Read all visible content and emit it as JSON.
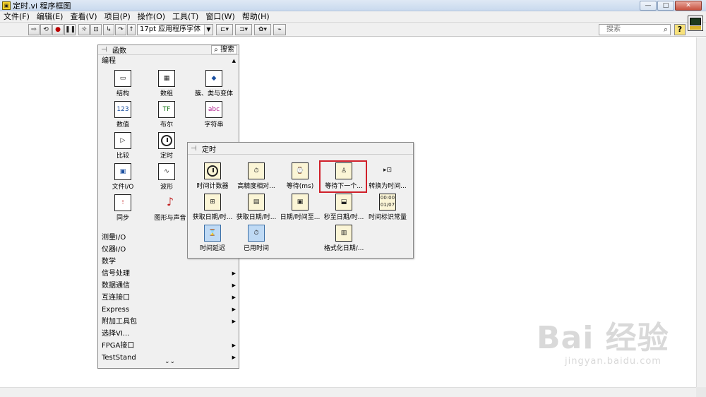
{
  "window": {
    "title": "定时.vi 程序框图",
    "buttons": [
      "—",
      "□",
      "✕"
    ]
  },
  "menu": [
    "文件(F)",
    "编辑(E)",
    "查看(V)",
    "项目(P)",
    "操作(O)",
    "工具(T)",
    "窗口(W)",
    "帮助(H)"
  ],
  "toolbar": {
    "font": "17pt 应用程序字体",
    "search_placeholder": "搜索",
    "help": "?"
  },
  "functions_palette": {
    "title": "函数",
    "search_label": "搜索",
    "section": "编程",
    "tiles": [
      "结构",
      "数组",
      "簇、类与变体",
      "数值",
      "布尔",
      "字符串",
      "比较",
      "定时",
      "",
      "文件I/O",
      "波形",
      "",
      "同步",
      "图形与声音",
      ""
    ],
    "categories": [
      {
        "label": "测量I/O",
        "arrow": false
      },
      {
        "label": "仪器I/O",
        "arrow": false
      },
      {
        "label": "数学",
        "arrow": false
      },
      {
        "label": "信号处理",
        "arrow": true
      },
      {
        "label": "数据通信",
        "arrow": true
      },
      {
        "label": "互连接口",
        "arrow": true
      },
      {
        "label": "Express",
        "arrow": true
      },
      {
        "label": "附加工具包",
        "arrow": true
      },
      {
        "label": "选择VI...",
        "arrow": false
      },
      {
        "label": "FPGA接口",
        "arrow": true
      },
      {
        "label": "TestStand",
        "arrow": true
      }
    ],
    "expand": "⌄⌄"
  },
  "timing_palette": {
    "title": "定时",
    "tiles": [
      "时间计数器",
      "高精度相对...",
      "等待(ms)",
      "等待下一个...",
      "转换为时间...",
      "获取日期/时...",
      "获取日期/时...",
      "日期/时间至...",
      "秒至日期/时...",
      "时间标识常量",
      "时间延迟",
      "已用时间",
      "",
      "",
      "格式化日期/..."
    ],
    "highlighted": "等待下一个..."
  },
  "watermark": {
    "brand": "Bai 经验",
    "url": "jingyan.baidu.com"
  }
}
